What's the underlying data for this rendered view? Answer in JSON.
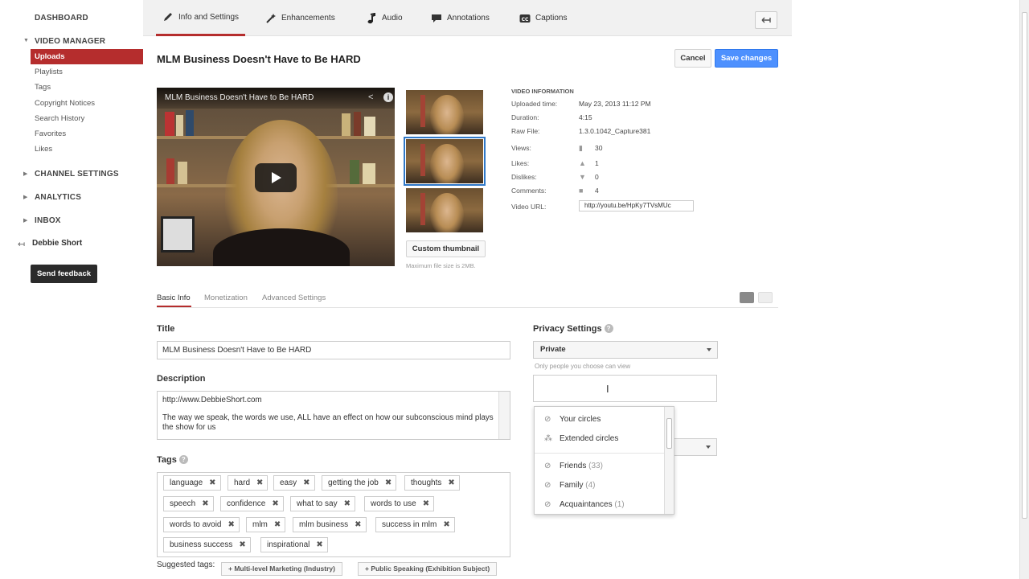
{
  "sidebar": {
    "dashboard": "DASHBOARD",
    "video_manager": "VIDEO MANAGER",
    "items": [
      "Uploads",
      "Playlists",
      "Tags",
      "Copyright Notices",
      "Search History",
      "Favorites",
      "Likes"
    ],
    "channel_settings": "CHANNEL SETTINGS",
    "analytics": "ANALYTICS",
    "inbox": "INBOX",
    "user": "Debbie Short",
    "feedback": "Send feedback"
  },
  "top_tabs": [
    "Info and Settings",
    "Enhancements",
    "Audio",
    "Annotations",
    "Captions"
  ],
  "header": {
    "title": "MLM Business Doesn't Have to Be HARD",
    "cancel": "Cancel",
    "save": "Save changes"
  },
  "player": {
    "title": "MLM Business Doesn't Have to Be HARD"
  },
  "thumbnails": {
    "custom_label": "Custom thumbnail",
    "max_size": "Maximum file size is 2MB."
  },
  "video_info": {
    "heading": "VIDEO INFORMATION",
    "uploaded_label": "Uploaded time:",
    "uploaded": "May 23, 2013 11:12 PM",
    "duration_label": "Duration:",
    "duration": "4:15",
    "raw_label": "Raw File:",
    "raw": "1.3.0.1042_Capture381",
    "views_label": "Views:",
    "views": "30",
    "likes_label": "Likes:",
    "likes": "1",
    "dislikes_label": "Dislikes:",
    "dislikes": "0",
    "comments_label": "Comments:",
    "comments": "4",
    "url_label": "Video URL:",
    "url": "http://youtu.be/HpKy7TVsMUc"
  },
  "sub_tabs": [
    "Basic Info",
    "Monetization",
    "Advanced Settings"
  ],
  "form": {
    "title_label": "Title",
    "title_value": "MLM Business Doesn't Have to Be HARD",
    "description_label": "Description",
    "description_line1": "http://www.DebbieShort.com",
    "description_line2": "The way we speak, the words we use, ALL have an effect on how our subconscious mind plays the show for us",
    "tags_label": "Tags",
    "tags": [
      "language",
      "hard",
      "easy",
      "getting the job",
      "thoughts",
      "speech",
      "confidence",
      "what to say",
      "words to use",
      "words to avoid",
      "mlm",
      "mlm business",
      "success in mlm",
      "business success",
      "inspirational"
    ],
    "suggested_label": "Suggested tags:",
    "suggested": [
      "+ Multi-level Marketing (Industry)",
      "+ Public Speaking (Exhibition Subject)"
    ]
  },
  "privacy": {
    "label": "Privacy Settings",
    "selected": "Private",
    "hint": "Only people you choose can view"
  },
  "dropdown": {
    "your_circles": "Your circles",
    "extended_circles": "Extended circles",
    "friends": "Friends",
    "friends_count": "(33)",
    "family": "Family",
    "family_count": "(4)",
    "acquaintances": "Acquaintances",
    "acquaintances_count": "(1)"
  }
}
